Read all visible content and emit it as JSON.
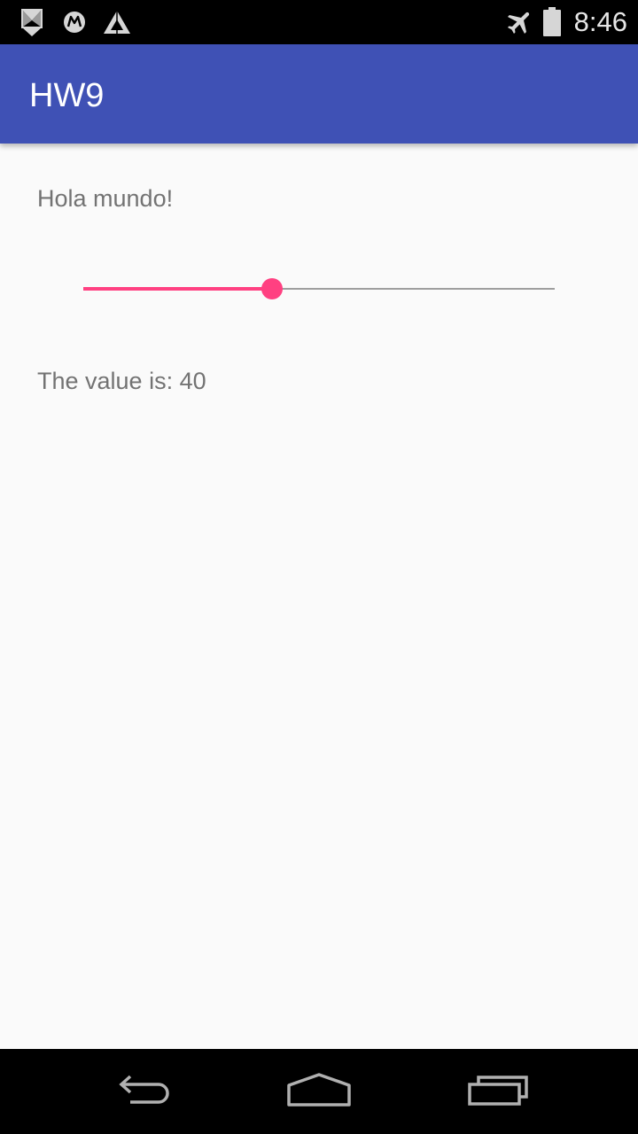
{
  "status_bar": {
    "time": "8:46",
    "left_icons": [
      "notification-icon",
      "motorola-icon",
      "triangle-logo-icon"
    ],
    "right_icons": [
      "airplane-mode-icon",
      "battery-icon"
    ]
  },
  "app_bar": {
    "title": "HW9",
    "color": "#3f51b5"
  },
  "main": {
    "greeting": "Hola mundo!",
    "slider": {
      "value_fraction": 0.4,
      "accent_color": "#ff4081"
    },
    "value_text": "The value is: 40"
  },
  "nav_bar": {
    "buttons": [
      "back-icon",
      "home-icon",
      "recents-icon"
    ]
  }
}
